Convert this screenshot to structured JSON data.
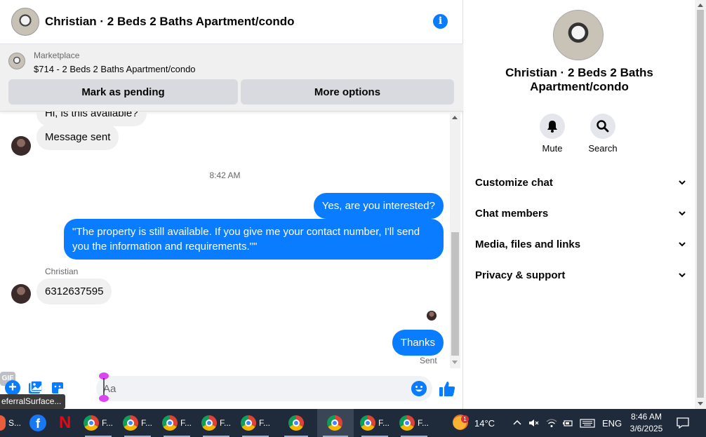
{
  "chat": {
    "title": "Christian · 2 Beds 2 Baths Apartment/condo",
    "info_icon": "info-icon"
  },
  "marketplace": {
    "label": "Marketplace",
    "listing": "$714 - 2 Beds 2 Baths Apartment/condo",
    "mark_pending": "Mark as pending",
    "more_options": "More options"
  },
  "messages": {
    "partial_first": "Hi, is this available?",
    "message_sent": "Message sent",
    "timestamp": "8:42 AM",
    "out_1": "Yes, are you interested?",
    "out_2": "\"The property is still available. If you give me your contact number, I'll send you the information and requirements.\"\"",
    "sender_name": "Christian",
    "in_number": "6312637595",
    "out_3": "Thanks",
    "sent_status": "Sent"
  },
  "composer": {
    "placeholder": "Aa",
    "gif_label": "GIF",
    "tooltip": "eferralSurface..."
  },
  "details": {
    "title": "Christian · 2 Beds 2 Baths Apartment/condo",
    "mute_label": "Mute",
    "search_label": "Search",
    "sections": [
      "Customize chat",
      "Chat members",
      "Media, files and links",
      "Privacy & support"
    ]
  },
  "taskbar": {
    "apps": [
      {
        "label": "S..."
      },
      {
        "label": "F..."
      },
      {
        "label": "F..."
      },
      {
        "label": "F..."
      },
      {
        "label": "F..."
      },
      {
        "label": "F..."
      },
      {
        "label": "F..."
      },
      {
        "label": "F..."
      }
    ],
    "weather": "14°C",
    "weather_badge": "1",
    "language": "ENG",
    "time": "8:46 AM",
    "date": "3/6/2025"
  },
  "colors": {
    "messenger_blue": "#0a7cff",
    "bubble_gray": "#f0f0f0",
    "taskbar_bg": "#1f2a3a"
  }
}
